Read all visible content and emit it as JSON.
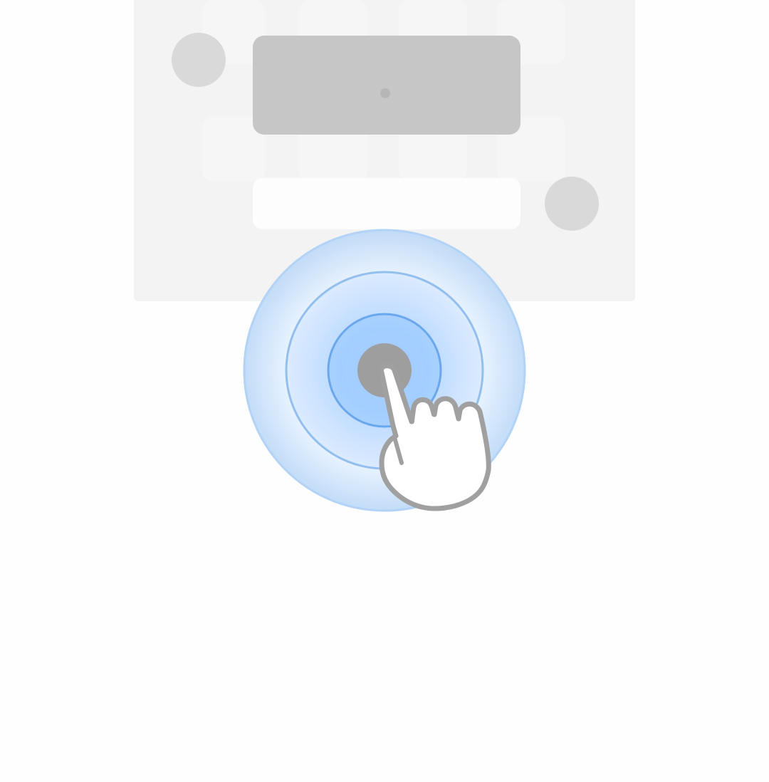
{
  "screen": {
    "background": "#fefefe"
  },
  "placeholder_card": {
    "background": "#f3f3f3",
    "avatar_color": "#d9d9d9",
    "preview_color": "#c6c6c6",
    "input_color": "#fdfdfd"
  },
  "gesture": {
    "type": "tap",
    "icon": "hand-pointer-icon",
    "ripple_color": "#8ec3ff",
    "touch_point_color": "#9e9e9e",
    "hand_outline_color": "#a0a0a0"
  }
}
